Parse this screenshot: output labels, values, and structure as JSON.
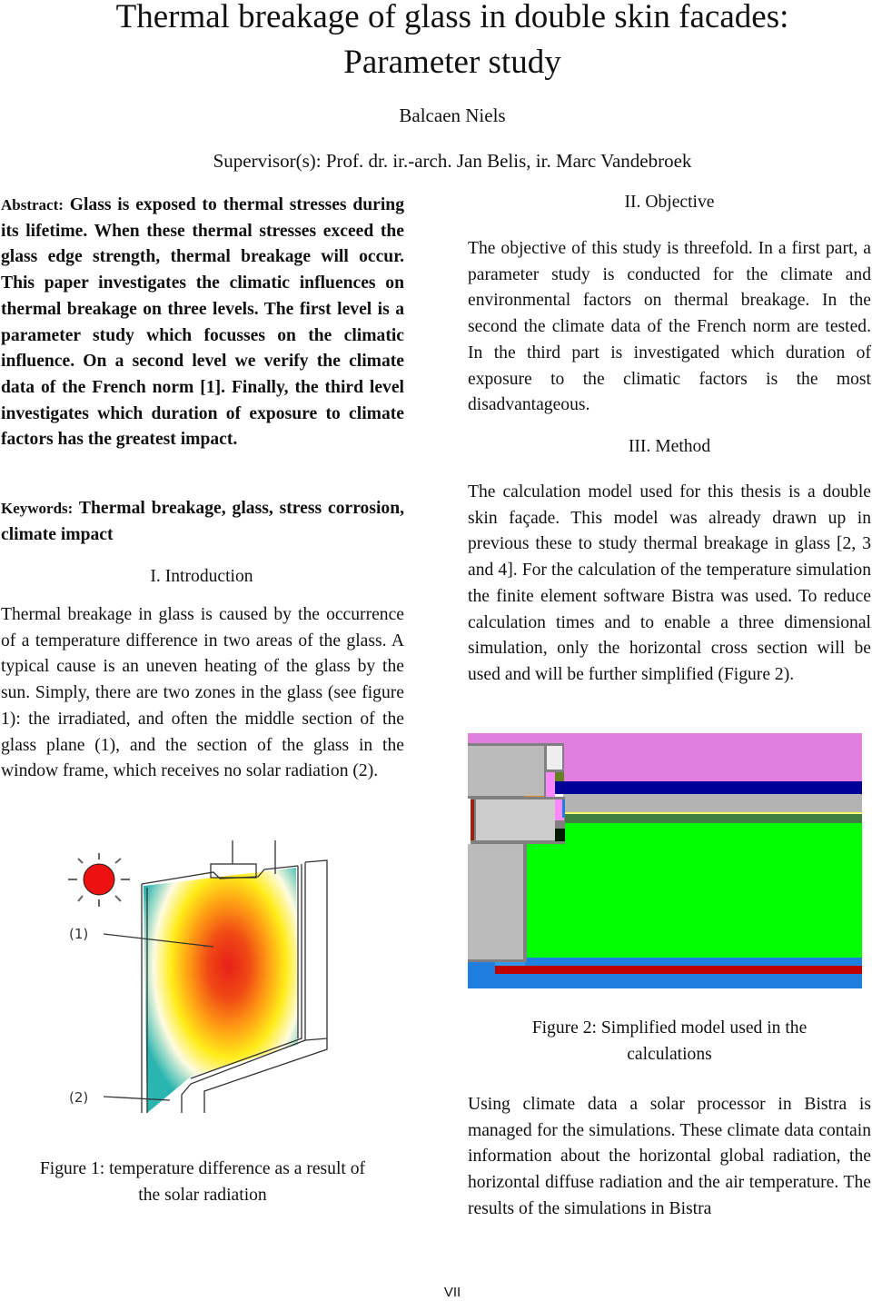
{
  "header": {
    "title_line1": "Thermal breakage of glass in double skin facades:",
    "title_line2": "Parameter study",
    "author": "Balcaen Niels",
    "supervisors": "Supervisor(s): Prof. dr. ir.-arch. Jan Belis, ir. Marc Vandebroek"
  },
  "abstract": {
    "label": "Abstract:",
    "text": "Glass is exposed to thermal stresses during its lifetime. When these thermal stresses exceed the glass edge strength, thermal breakage will occur. This paper investigates the climatic influences on thermal breakage on three levels. The first level is a parameter study which focusses on the climatic influence. On a second level we verify the climate data of the French norm [1]. Finally, the third level investigates which duration of exposure to climate factors has the greatest impact."
  },
  "keywords": {
    "label": "Keywords:",
    "text": "Thermal breakage, glass, stress corrosion, climate impact"
  },
  "sections": {
    "introduction": {
      "heading": "I. Introduction",
      "text": "Thermal breakage in glass is caused by the occurrence of a temperature difference in two areas of the glass. A typical cause is an uneven heating of the glass by the sun. Simply, there are two zones in the glass (see figure 1): the irradiated, and often the middle section of the glass plane (1), and the section of the glass in the window frame, which receives no solar radiation (2)."
    },
    "objective": {
      "heading": "II. Objective",
      "text": "The objective of this study is threefold. In a first part, a parameter study is conducted for the climate and environmental factors on thermal breakage. In the second the climate data of the French norm are tested. In the third part is investigated which duration of exposure to the climatic factors is the most disadvantageous."
    },
    "method": {
      "heading": "III. Method",
      "text1": "The calculation model used for this thesis is a double skin façade. This model was already drawn up in previous these to study thermal breakage in glass [2, 3 and 4]. For the calculation of the temperature simulation the finite element software Bistra was used. To reduce calculation times and to enable a three dimensional simulation, only the horizontal cross section will be used and will be further simplified (Figure 2).",
      "text2": "Using climate data a solar processor in Bistra is managed for the simulations. These climate data contain information about the horizontal global radiation, the horizontal diffuse radiation and the air temperature. The results of the simulations in Bistra"
    }
  },
  "figure1": {
    "label_1": "(1)",
    "label_2": "(2)",
    "caption_line1": "Figure 1: temperature difference as a result of",
    "caption_line2": "the solar radiation",
    "colors": {
      "sun": "#ee1111",
      "hot": "#e8201a",
      "warm": "#ffec1a",
      "cool": "#2bb5b0"
    }
  },
  "figure2": {
    "caption_line1": "Figure 2: Simplified model used in the",
    "caption_line2": "calculations",
    "colors": {
      "pink": "#e07fdf",
      "navy": "#000099",
      "grey": "#b3b3b3",
      "dark_green": "#3f7f3f",
      "green": "#00ff00",
      "blue": "#1f7fdf",
      "red": "#bf0000",
      "frame": "#808080",
      "light_grey": "#cccccc",
      "yellow": "#ffff33"
    }
  },
  "footer": {
    "page_number": "VII"
  }
}
